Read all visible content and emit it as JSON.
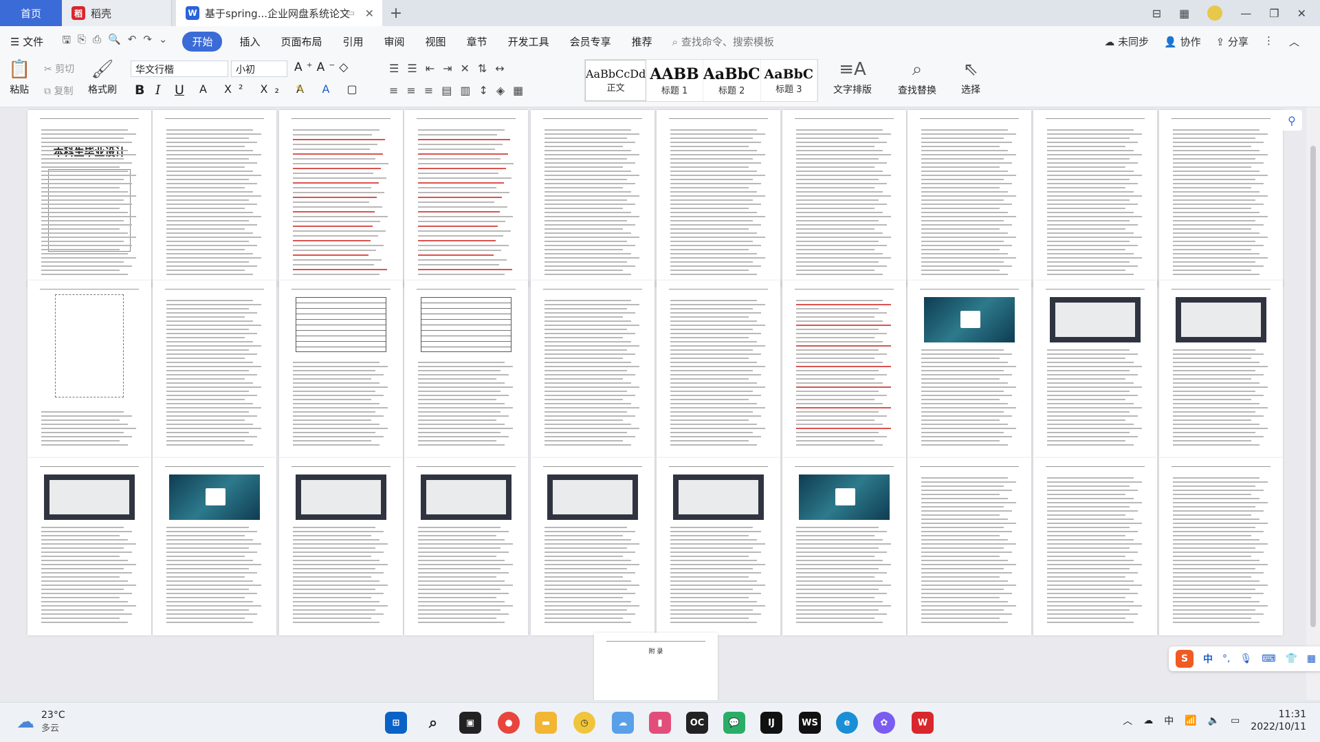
{
  "tabs": {
    "home": "首页",
    "daoke": "稻壳",
    "doc": "基于spring...企业网盘系统论文",
    "new": "+"
  },
  "menu": {
    "file": "文件",
    "start": "开始",
    "insert": "插入",
    "layout": "页面布局",
    "ref": "引用",
    "review": "审阅",
    "view": "视图",
    "chapter": "章节",
    "dev": "开发工具",
    "vip": "会员专享",
    "recommend": "推荐",
    "search": "查找命令、搜索模板",
    "sync": "未同步",
    "collab": "协作",
    "share": "分享"
  },
  "ribbon": {
    "paste": "粘贴",
    "cut": "剪切",
    "copy": "复制",
    "format_painter": "格式刷",
    "font": "华文行楷",
    "size": "小初",
    "bold": "B",
    "italic": "I",
    "underline": "U",
    "styles": [
      {
        "preview": "AaBbCcDd",
        "label": "正文"
      },
      {
        "preview": "AABB",
        "label": "标题 1"
      },
      {
        "preview": "AaBbC",
        "label": "标题 2"
      },
      {
        "preview": "AaBbC",
        "label": "标题 3"
      }
    ],
    "text_layout": "文字排版",
    "find_replace": "查找替换",
    "select": "选择"
  },
  "document": {
    "cover_title": "本科生毕业设计",
    "last_page_label": "附 录"
  },
  "taskbar": {
    "temp": "23°C",
    "weather": "多云",
    "time": "11:31",
    "date": "2022/10/11",
    "ime": "中"
  },
  "colors": {
    "accent": "#3b6bd6",
    "wps_red": "#d8272d"
  }
}
